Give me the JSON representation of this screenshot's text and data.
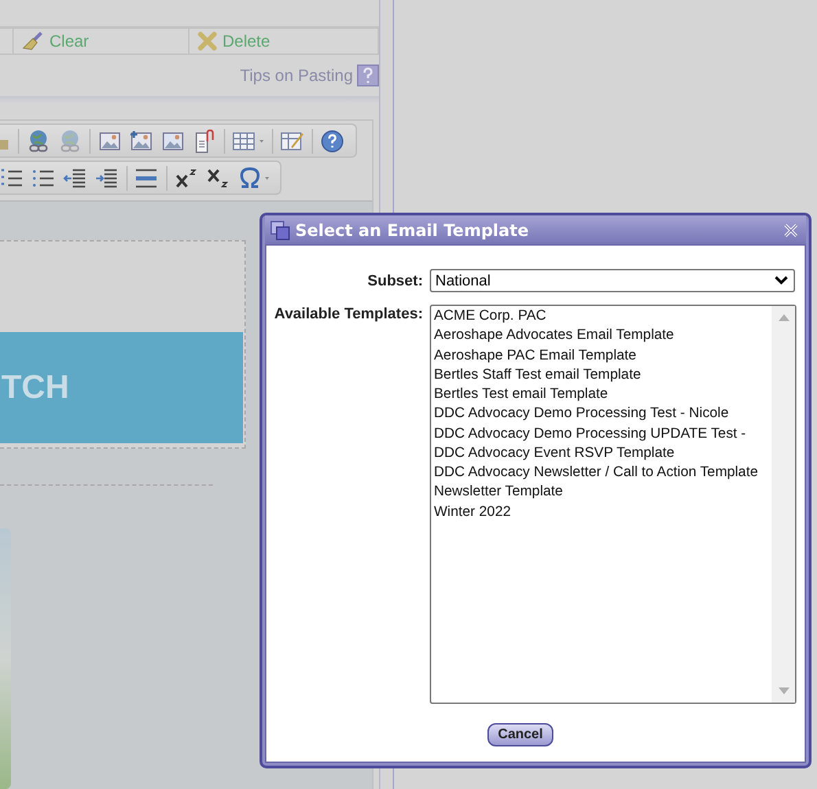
{
  "background": {
    "action_buttons": [
      {
        "label": "Clear",
        "kind": "clear"
      },
      {
        "label": "Delete",
        "kind": "delete"
      }
    ],
    "tips_link": "Tips on Pasting",
    "banner_text": "TCH"
  },
  "dialog": {
    "title": "Select an Email Template",
    "subset": {
      "label": "Subset:",
      "value": "National"
    },
    "templates": {
      "label": "Available Templates:",
      "items": [
        {
          "label": "ACME Corp. PAC",
          "selected": false
        },
        {
          "label": "Aeroshape Advocates Email Template",
          "selected": false
        },
        {
          "label": "Aeroshape PAC Email Template",
          "selected": false
        },
        {
          "label": "Bertles Staff Test email Template",
          "selected": false
        },
        {
          "label": "Bertles Test email Template",
          "selected": false
        },
        {
          "label": "DDC Advocacy Demo Processing Test - Nicole",
          "selected": false
        },
        {
          "label": "DDC Advocacy Demo Processing UPDATE Test -",
          "selected": false
        },
        {
          "label": "DDC Advocacy Event RSVP Template",
          "selected": false
        },
        {
          "label": "DDC Advocacy Newsletter / Call to Action Template",
          "selected": false
        },
        {
          "label": "Newsletter Template",
          "selected": false
        },
        {
          "label": "Winter 2022",
          "selected": false
        }
      ]
    },
    "buttons": [
      {
        "label": "Cancel"
      }
    ]
  }
}
